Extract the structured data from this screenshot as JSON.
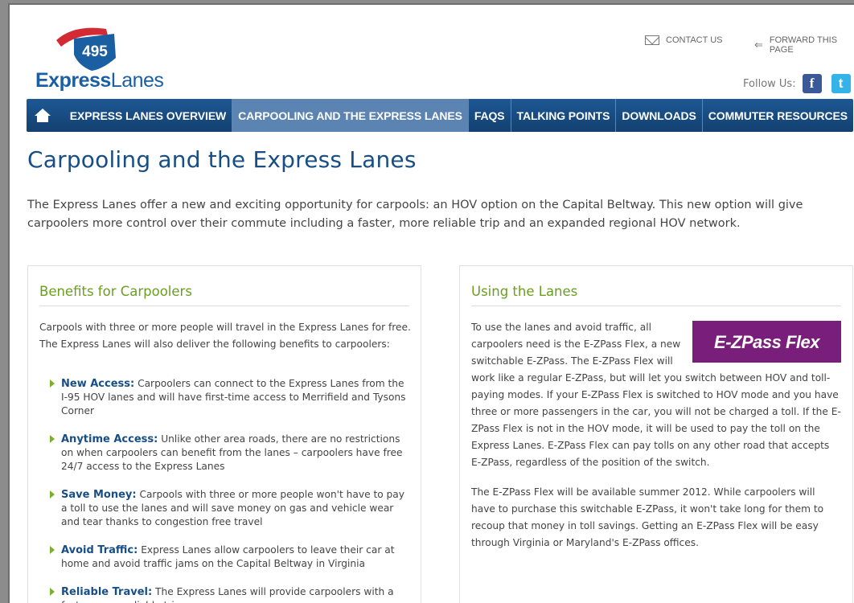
{
  "logo": {
    "shield_number": "495",
    "brand_bold": "Express",
    "brand_light": "Lanes"
  },
  "utility": {
    "contact": "CONTACT US",
    "forward": "FORWARD THIS PAGE"
  },
  "social": {
    "follow_label": "Follow Us:",
    "facebook": "f",
    "twitter": "t"
  },
  "nav": {
    "items": [
      {
        "label": "EXPRESS LANES OVERVIEW"
      },
      {
        "label": "CARPOOLING AND THE EXPRESS LANES"
      },
      {
        "label": "FAQS"
      },
      {
        "label": "TALKING POINTS"
      },
      {
        "label": "DOWNLOADS"
      },
      {
        "label": "COMMUTER RESOURCES"
      }
    ],
    "active_index": 1
  },
  "page": {
    "title": "Carpooling and the Express Lanes",
    "intro": "The Express Lanes offer a new and exciting opportunity for carpools: an HOV option on the Capital Beltway. This new option will give carpoolers more control over their commute including a faster, more reliable trip and an expanded regional HOV network."
  },
  "benefits": {
    "heading": "Benefits for Carpoolers",
    "intro": "Carpools with three or more people will travel in the Express Lanes for free. The Express Lanes will also deliver the following benefits to carpoolers:",
    "items": [
      {
        "term": "New Access:",
        "text": " Carpoolers can connect to the Express Lanes from the I-95 HOV lanes and will have first-time access to Merrifield and Tysons Corner"
      },
      {
        "term": "Anytime Access:",
        "text": " Unlike other area roads, there are no restrictions on when carpoolers can benefit from the lanes – carpoolers have free 24/7 access to the Express Lanes"
      },
      {
        "term": "Save Money:",
        "text": " Carpools with three or more people won't have to pay a toll to use the lanes and will save money on gas and vehicle wear and tear thanks to congestion free travel"
      },
      {
        "term": "Avoid Traffic:",
        "text": " Express Lanes allow carpoolers to leave their car at home and avoid traffic jams on the Capital Beltway in Virginia"
      },
      {
        "term": "Reliable Travel:",
        "text": " The Express Lanes will provide carpoolers with a faster, more reliable trip"
      }
    ]
  },
  "using": {
    "heading": "Using the Lanes",
    "ezpass_logo": "E-ZPass Flex",
    "paragraph1": "To use the lanes and avoid traffic, all carpoolers need is the E-ZPass Flex, a new switchable E-ZPass. The E-ZPass Flex will work like a regular E-ZPass, but will let you switch between HOV and toll-paying modes. If your E-ZPass Flex is switched to HOV mode and you have three or more passengers in the car, you will not be charged a toll. If the E-ZPass Flex is not in the HOV mode, it will be used to pay the toll on the Express Lanes. E-ZPass Flex can pay tolls on any other road that accepts E-ZPass, regardless of the position of the switch.",
    "paragraph2": "The E-ZPass Flex will be available summer 2012. While carpoolers will have to purchase this switchable E-ZPass, it won't take long for them to recoup that money in toll savings. Getting an E-ZPass Flex will be easy through Virginia or Maryland's E-ZPass offices."
  },
  "colors": {
    "nav": "#1d5895",
    "nav_active": "#5b84b3",
    "title": "#174e86",
    "heading_green": "#6a9e1f",
    "ezpass_purple": "#7a1e7b",
    "logo_red": "#d42a33"
  }
}
